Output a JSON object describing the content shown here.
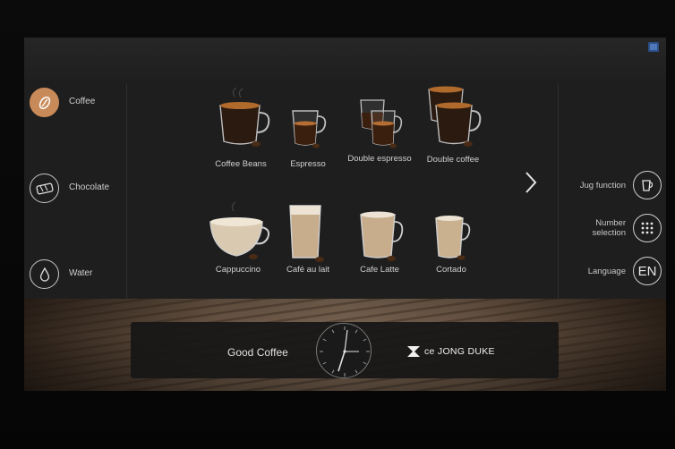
{
  "categories": [
    {
      "label": "Coffee",
      "icon": "coffee-bean-icon",
      "active": true
    },
    {
      "label": "Chocolate",
      "icon": "chocolate-icon",
      "active": false
    },
    {
      "label": "Water",
      "icon": "water-drop-icon",
      "active": false
    }
  ],
  "products": {
    "row1": [
      "Coffee Beans",
      "Espresso",
      "Double espresso",
      "Double coffee"
    ],
    "row2": [
      "Cappuccino",
      "Café au lait",
      "Cafe Latte",
      "Cortado"
    ]
  },
  "functions": {
    "jug": {
      "label": "Jug function",
      "icon": "jug-icon"
    },
    "number": {
      "label_line1": "Number",
      "label_line2": "selection",
      "icon": "keypad-icon"
    },
    "language": {
      "label": "Language",
      "value": "EN"
    }
  },
  "footer": {
    "tagline": "Good Coffee",
    "brand": "ce JONG DUKE"
  },
  "colors": {
    "accent": "#c98a59",
    "screen_bg": "#1e1e1e"
  }
}
